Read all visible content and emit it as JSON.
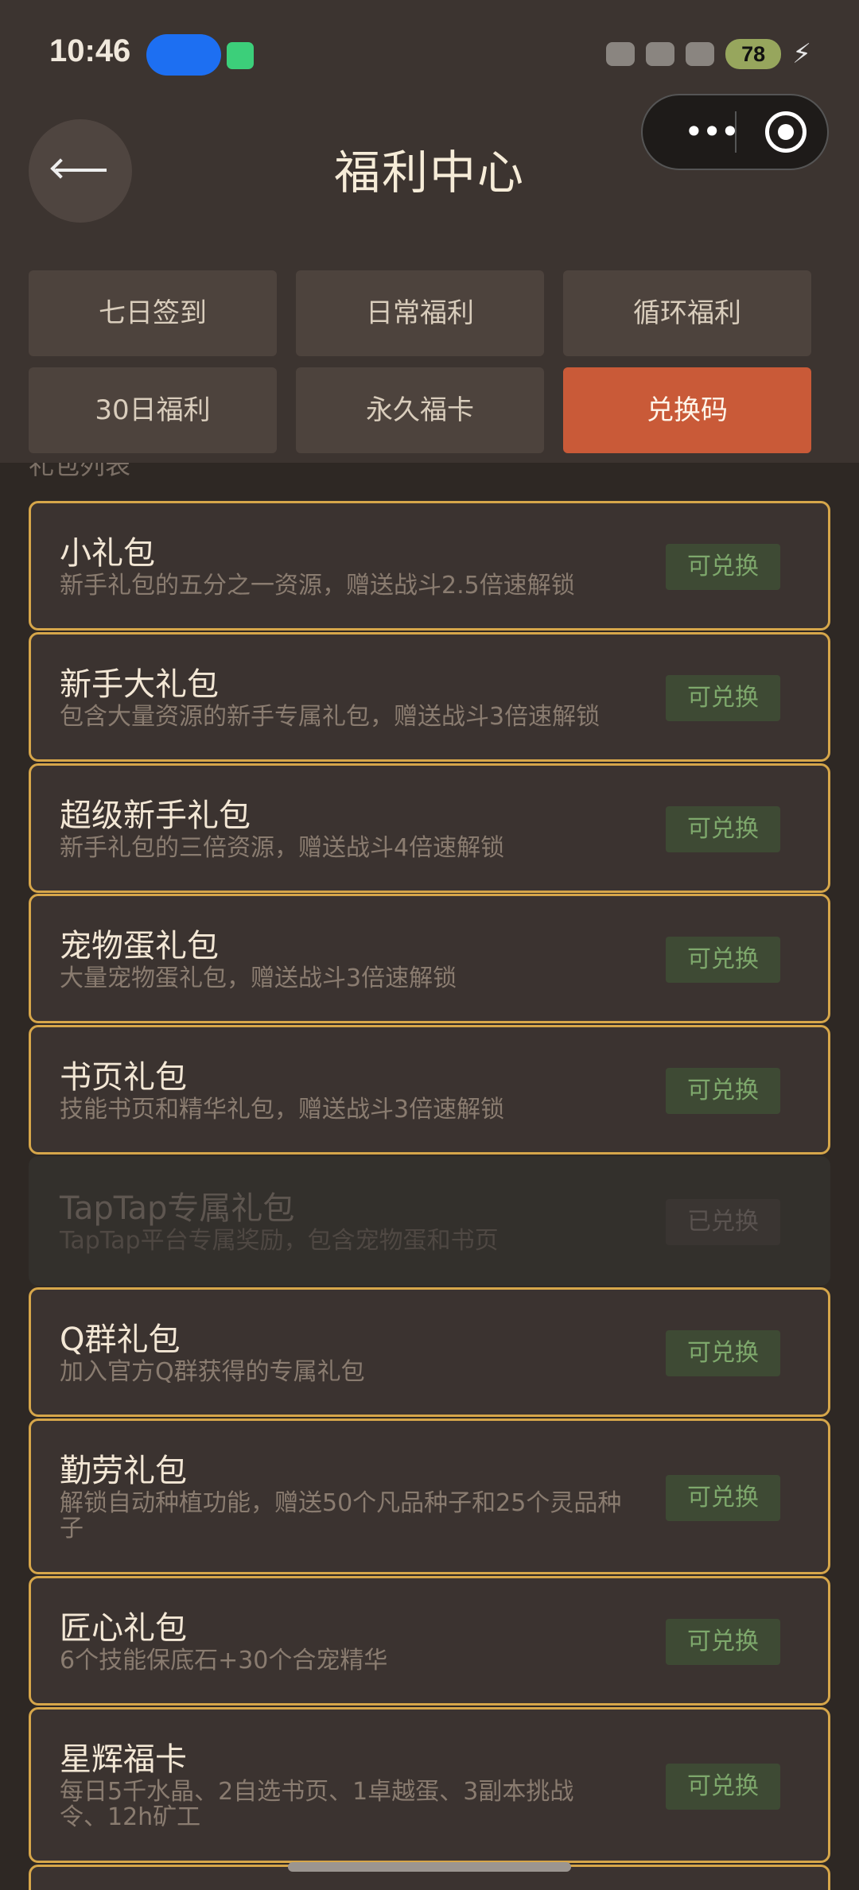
{
  "status_bar": {
    "time": "10:46",
    "battery": "78"
  },
  "header": {
    "title": "福利中心"
  },
  "tabs": [
    {
      "label": "七日签到",
      "active": false
    },
    {
      "label": "日常福利",
      "active": false
    },
    {
      "label": "循环福利",
      "active": false
    },
    {
      "label": "30日福利",
      "active": false
    },
    {
      "label": "永久福卡",
      "active": false
    },
    {
      "label": "兑换码",
      "active": true
    }
  ],
  "section_label": "礼包列表",
  "gifts": [
    {
      "name": "小礼包",
      "desc": "新手礼包的五分之一资源，赠送战斗2.5倍速解锁",
      "button": "可兑换",
      "available": true
    },
    {
      "name": "新手大礼包",
      "desc": "包含大量资源的新手专属礼包，赠送战斗3倍速解锁",
      "button": "可兑换",
      "available": true
    },
    {
      "name": "超级新手礼包",
      "desc": "新手礼包的三倍资源，赠送战斗4倍速解锁",
      "button": "可兑换",
      "available": true
    },
    {
      "name": "宠物蛋礼包",
      "desc": "大量宠物蛋礼包，赠送战斗3倍速解锁",
      "button": "可兑换",
      "available": true
    },
    {
      "name": "书页礼包",
      "desc": "技能书页和精华礼包，赠送战斗3倍速解锁",
      "button": "可兑换",
      "available": true
    },
    {
      "name": "TapTap专属礼包",
      "desc": "TapTap平台专属奖励，包含宠物蛋和书页",
      "button": "已兑换",
      "available": false
    },
    {
      "name": "Q群礼包",
      "desc": "加入官方Q群获得的专属礼包",
      "button": "可兑换",
      "available": true
    },
    {
      "name": "勤劳礼包",
      "desc": "解锁自动种植功能，赠送50个凡品种子和25个灵品种子",
      "button": "可兑换",
      "available": true
    },
    {
      "name": "匠心礼包",
      "desc": "6个技能保底石+30个合宠精华",
      "button": "可兑换",
      "available": true
    },
    {
      "name": "星辉福卡",
      "desc": "每日5千水晶、2自选书页、1卓越蛋、3副本挑战令、12h矿工",
      "button": "可兑换",
      "available": true
    }
  ]
}
